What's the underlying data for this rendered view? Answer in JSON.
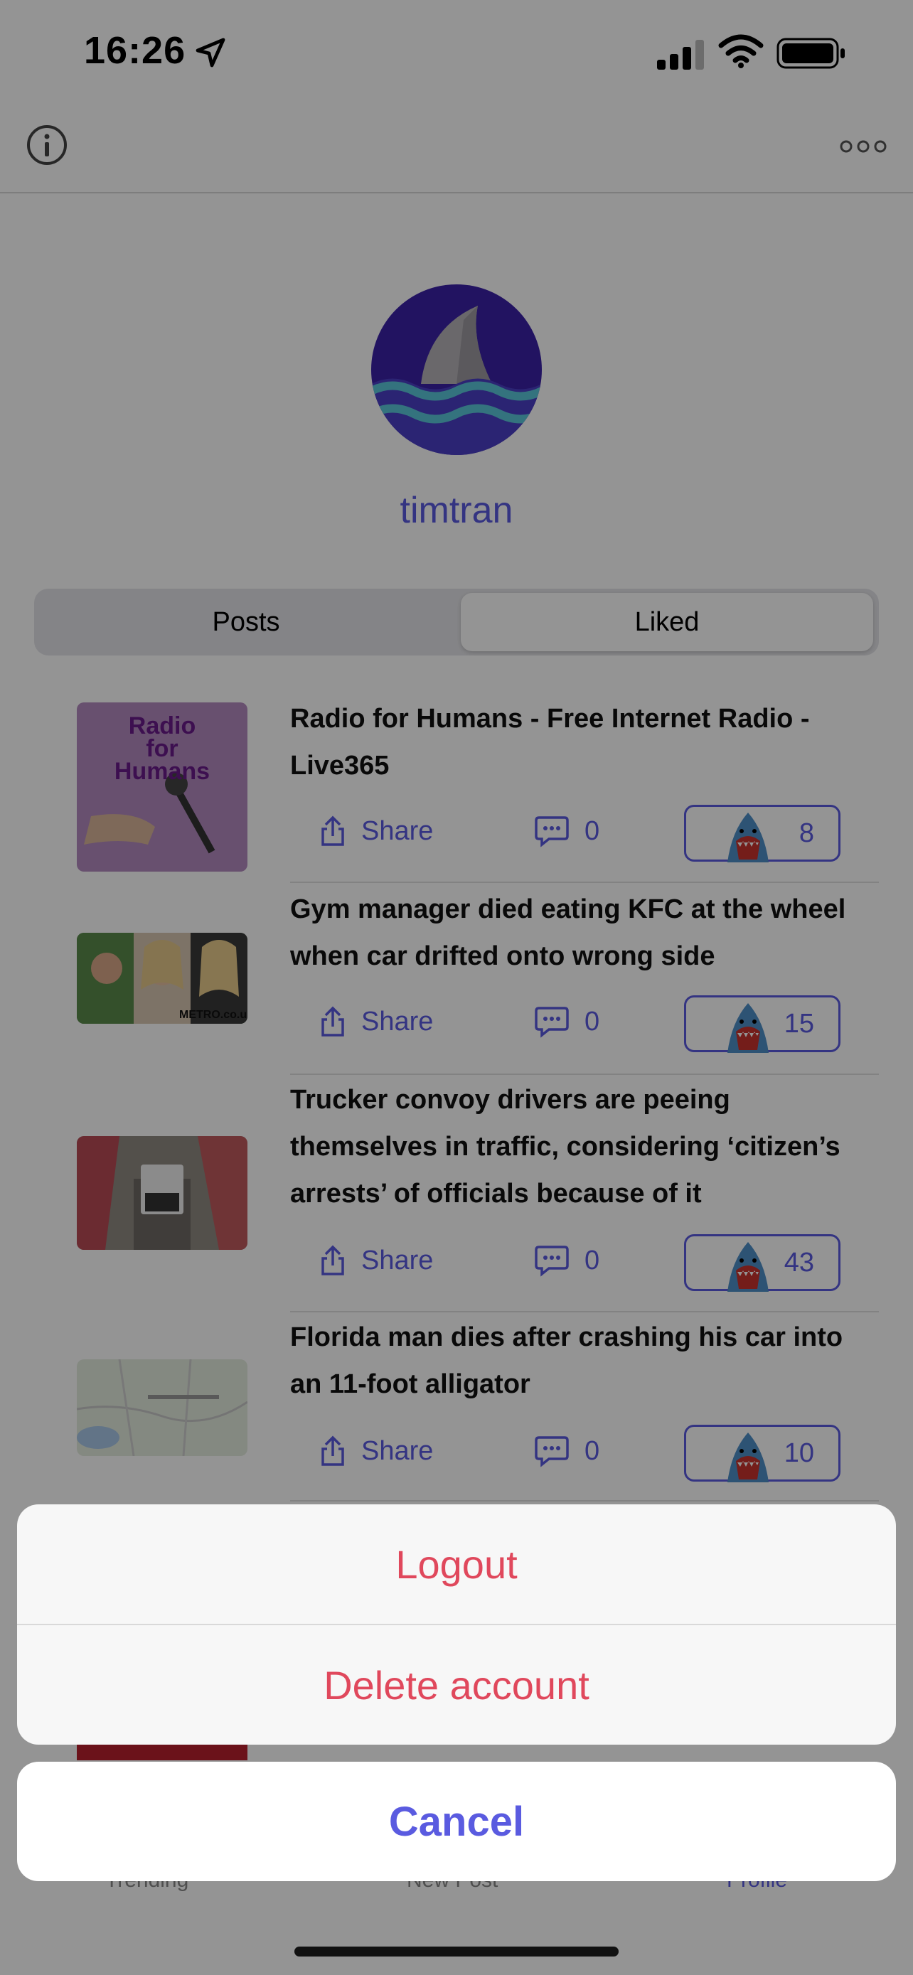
{
  "status_bar": {
    "time": "16:26"
  },
  "profile": {
    "username": "timtran"
  },
  "tabs": {
    "posts": "Posts",
    "liked": "Liked",
    "selected": "Liked"
  },
  "posts": [
    {
      "title": "Radio for Humans - Free Internet Radio - Live365",
      "share": "Share",
      "comments": "0",
      "likes": "8",
      "thumb_text": [
        "Radio",
        "for",
        "Humans"
      ]
    },
    {
      "title": "Gym manager died eating KFC at the wheel when car drifted onto wrong side",
      "share": "Share",
      "comments": "0",
      "likes": "15",
      "thumb_text": [
        "METRO.co.uk"
      ]
    },
    {
      "title": "Trucker convoy drivers are peeing themselves in traffic, considering ‘citizen’s arrests’ of officials because of it",
      "share": "Share",
      "comments": "0",
      "likes": "43"
    },
    {
      "title": "Florida man dies after crashing his car into an 11-foot alligator",
      "share": "Share",
      "comments": "0",
      "likes": "10"
    }
  ],
  "tab_bar": {
    "trending": "Trending",
    "new_post": "New Post",
    "profile": "Profile"
  },
  "action_sheet": {
    "logout": "Logout",
    "delete": "Delete account",
    "cancel": "Cancel"
  },
  "colors": {
    "accent": "#5a5be0",
    "destructive": "#e0485c"
  }
}
